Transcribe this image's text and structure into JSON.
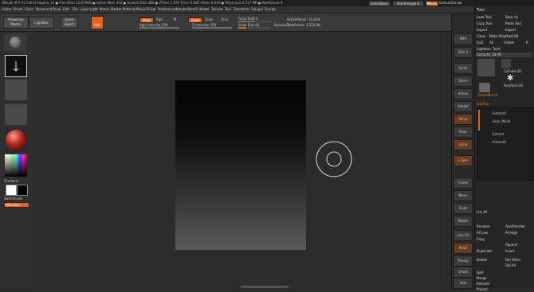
{
  "titlebar": {
    "text": "ZBrush 4R7 P3 Cell13  Hagma_12   ● Free Mem 12.879GB ● Active Mem 352 ● Scratch Disk 4B4 ● ZTime 1.376 Timer 0.082 ATime 0.016 ● PolyCount 4.217 MP ● MeshCount 9",
    "quicksave": "QuickSave",
    "seethrough": "See-through  0",
    "menus_label": "Menus",
    "script_label": "DefaultZScript"
  },
  "menubar": {
    "items": [
      "Alpha",
      "Brush",
      "Color",
      "Document",
      "Draw",
      "Edit",
      "File",
      "Layer",
      "Light",
      "Macro",
      "Marker",
      "Material",
      "Movie",
      "Picker",
      "Preferences",
      "Render",
      "Stencil",
      "Stroke",
      "Texture",
      "Tool",
      "Transform",
      "Zplugin",
      "Zscript"
    ]
  },
  "toolbar": {
    "projection_master": "Projection Master",
    "lightbox": "LightBox",
    "quick_sketch": "Quick Sketch",
    "edit": "Edit",
    "mrgb": "Mrgb",
    "rgb": "Rgb",
    "m": "M",
    "zadd": "Zadd",
    "zsub": "Zsub",
    "zcut": "Zcut",
    "rgb_intensity": "Rgb Intensity 100",
    "z_intensity": "Z Intensity 100",
    "focal_shift": "Focal Shift 0",
    "draw_size": "Draw Size 64",
    "dynamic": "Dynamic",
    "active_points": "ActivePoints: 16,818",
    "total_points": "TotalPoints: 4.223 Mil",
    "rgb_intensity_value": 1.0,
    "z_intensity_value": 1.0,
    "draw_size_value": 0.25
  },
  "leftshelf": {
    "gradient": "Gradient",
    "switch_color": "SwitchColor",
    "alternate": "Alternate",
    "colors": {
      "main": "#ffffff",
      "secondary": "#000000"
    }
  },
  "rightshelf": {
    "items": [
      "BPR",
      "SPix 3",
      "Scroll",
      "Zoom",
      "Actual",
      "AAHalf",
      "Persp",
      "Floor",
      "Local",
      "L.Sym",
      "Frame",
      "Move",
      "Scale",
      "Rotate",
      "Line Fill",
      "PolyF",
      "Transp",
      "Ghost",
      "Solo",
      "Xpose"
    ]
  },
  "toolpanel": {
    "title": "Tool",
    "load_tool": "Load Tool",
    "save_as": "Save As",
    "copy_tool": "Copy Tool",
    "paste_tool": "Paste Tool",
    "import": "Import",
    "export": "Export",
    "clone": "Clone",
    "make_polymesh": "Make PolyMesh3D",
    "goz": "GoZ",
    "all": "All",
    "visible": "Visible",
    "r": "R",
    "lightbox_tools": "Lightbox› Tools",
    "extract_label": "Extract0_1B  49",
    "r_badge": "R",
    "tool_thumbs": [
      "Extract0",
      "Cylinder3D",
      "PolyMesh3D",
      "SimpleBrush"
    ],
    "subtool_header": "SubTool",
    "subtools": [
      "Extract0",
      "Gear_Mesh",
      "Extract",
      "Extract0"
    ],
    "list_all": "List All",
    "rename": "Rename",
    "autoreorder": "AutoReorder",
    "all_low": "All Low",
    "all_high": "All High",
    "copy": "Copy",
    "paste": "Paste",
    "append": "Append",
    "duplicate": "Duplicate",
    "insert": "Insert",
    "delete": "Delete",
    "del_other": "Del Other",
    "del_all": "Del All",
    "split": "Split",
    "merge": "Merge",
    "remesh": "Remesh",
    "project": "Project"
  },
  "accent_color": "#e2631b"
}
